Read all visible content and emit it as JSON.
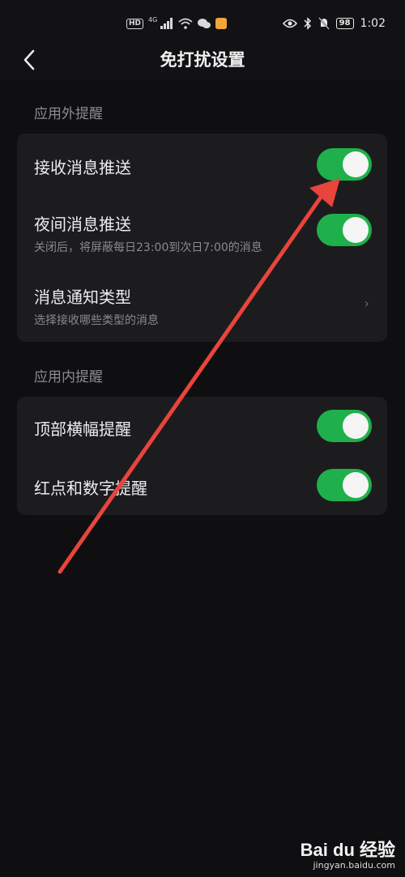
{
  "status": {
    "hd": "HD",
    "net": "4G",
    "battery": "98",
    "time": "1:02"
  },
  "header": {
    "title": "免打扰设置"
  },
  "sections": [
    {
      "label": "应用外提醒",
      "items": [
        {
          "title": "接收消息推送",
          "toggle": true
        },
        {
          "title": "夜间消息推送",
          "subtitle": "关闭后，将屏蔽每日23:00到次日7:00的消息",
          "toggle": true
        },
        {
          "title": "消息通知类型",
          "subtitle": "选择接收哪些类型的消息",
          "chevron": "›"
        }
      ]
    },
    {
      "label": "应用内提醒",
      "items": [
        {
          "title": "顶部横幅提醒",
          "toggle": true
        },
        {
          "title": "红点和数字提醒",
          "toggle": true
        }
      ]
    }
  ],
  "colors": {
    "background": "#0f0f11",
    "card": "#1c1c1f",
    "toggle_on": "#1fb04b",
    "annotation_arrow": "#e8453c"
  },
  "watermark": {
    "logo": "Bai du 经验",
    "url": "jingyan.baidu.com"
  }
}
